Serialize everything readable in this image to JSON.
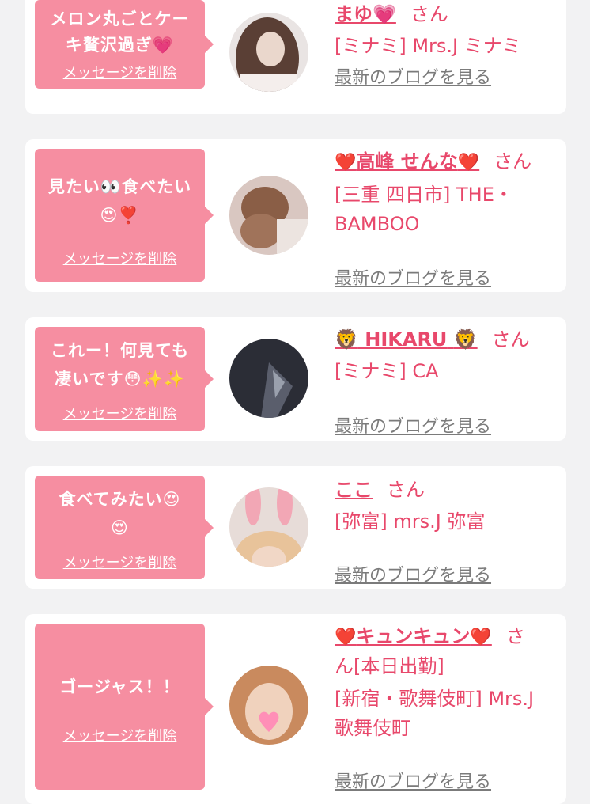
{
  "messages": [
    {
      "comment": [
        "メロン丸ごとケー",
        "キ贅沢過ぎ💗"
      ],
      "delete_label": "メッセージを削除",
      "name_prefix": "",
      "name": "まゆ",
      "name_suffix": "💗",
      "honorific": "さん",
      "shop": [
        "[ミナミ] Mrs.J ミナミ"
      ],
      "blog_label": "最新のブログを見る"
    },
    {
      "comment": [
        "見たい👀食べたい",
        "😍❣️"
      ],
      "delete_label": "メッセージを削除",
      "name_prefix": "❤️",
      "name": "高峰 せんな",
      "name_suffix": "❤️",
      "honorific": "さん",
      "shop": [
        "[三重 四日市] THE・",
        "BAMBOO"
      ],
      "blog_label": "最新のブログを見る"
    },
    {
      "comment": [
        "これー！何見ても",
        "凄いです😳✨✨"
      ],
      "delete_label": "メッセージを削除",
      "name_prefix": "🦁",
      "name": "HIKARU",
      "name_suffix": "🦁",
      "honorific": "さん",
      "shop": [
        "[ミナミ] CA"
      ],
      "blog_label": "最新のブログを見る"
    },
    {
      "comment": [
        "食べてみたい😍",
        "😍"
      ],
      "delete_label": "メッセージを削除",
      "name_prefix": "",
      "name": "ここ",
      "name_suffix": "",
      "honorific": "さん",
      "shop": [
        "[弥富] mrs.J 弥富"
      ],
      "blog_label": "最新のブログを見る"
    },
    {
      "comment": [
        "ゴージャス！！"
      ],
      "delete_label": "メッセージを削除",
      "name_prefix": "❤️",
      "name": "キュンキュン",
      "name_suffix": "❤️",
      "honorific": "さ",
      "honorific_cont": "ん[本日出勤]",
      "shop": [
        "[新宿・歌舞伎町] Mrs.J",
        "歌舞伎町"
      ],
      "blog_label": "最新のブログを見る"
    }
  ]
}
